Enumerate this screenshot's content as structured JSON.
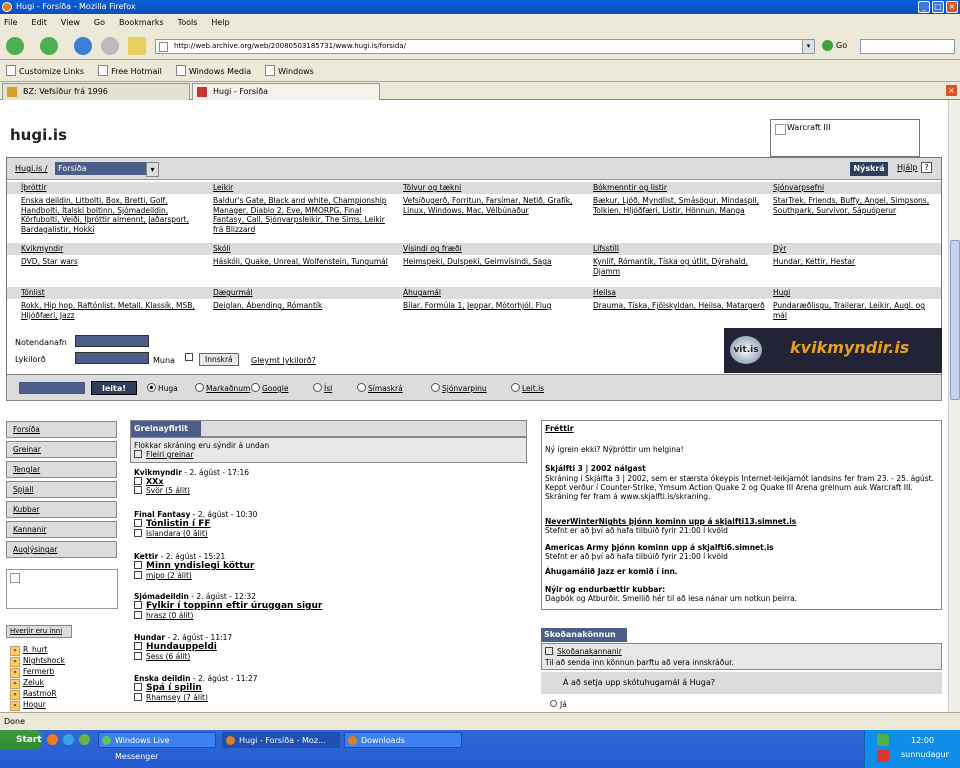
{
  "window": {
    "title": "Hugi - Forsíða - Mozilla Firefox"
  },
  "menu": [
    "File",
    "Edit",
    "View",
    "Go",
    "Bookmarks",
    "Tools",
    "Help"
  ],
  "nav": {
    "url": "http://web.archive.org/web/20080503185731/www.hugi.is/forsida/",
    "go_label": "Go"
  },
  "bookmarks": [
    "Customize Links",
    "Free Hotmail",
    "Windows Media",
    "Windows"
  ],
  "tabs": [
    {
      "label": "BZ: Vefsíður frá 1996"
    },
    {
      "label": "Hugi - Forsíða"
    }
  ],
  "page": {
    "logo": "hugi.is",
    "ad_label": "Warcraft III",
    "crumb": "Hugi.is /",
    "crumb_select": "Forsíða",
    "nyskra": "Nýskrá",
    "hjalp": "Hjálp",
    "categories": [
      {
        "head": "Íþróttir",
        "links": "Enska deildin, Litbolti, Box, Bretti, Golf, Handbolti, Ítalski boltinn, Sjómadeildin, Körfubolti, Veiði, Íþróttir almennt, Jaðarsport, Bardagalistir, Hokkí"
      },
      {
        "head": "Leikir",
        "links": "Baldur's Gate, Black and white, Championship Manager, Diablo 2, Eve, MMORPG, Final Fantasy, Call, Sjónvarpsleikir, The Sims, Leikir frá Blizzard"
      },
      {
        "head": "Tölvur og tækni",
        "links": "Vefsíðugerð, Forritun, Farsímar, Netið, Grafík, Linux, Windows, Mac, Vélbúnaður"
      },
      {
        "head": "Bókmenntir og listir",
        "links": "Bækur, Ljóð, Myndlist, Smásögur, Mindaspil, Tolkien, Hljóðfæri, Listir, Hönnun, Manga"
      },
      {
        "head": "Sjónvarpsefni",
        "links": "StarTrek, Friends, Buffy, Angel, Simpsons, Southpark, Survivor, Sápuóperur"
      },
      {
        "head": "Kvikmyndir",
        "links": "DVD, Star wars"
      },
      {
        "head": "Skóli",
        "links": "Háskóli, Quake, Unreal, Wolfenstein, Tungumál"
      },
      {
        "head": "Vísindi og fræði",
        "links": "Heimspeki, Dulspeki, Geimvísindi, Saga"
      },
      {
        "head": "Lífsstíll",
        "links": "Kynlíf, Rómantík, Tíska og útlit, Dýrahald, Djamm"
      },
      {
        "head": "Dýr",
        "links": "Hundar, Kettir, Hestar"
      },
      {
        "head": "Tónlist",
        "links": "Rokk, Hip hop, Raftónlist, Metall, Klassík, MSB, Hljóðfæri, Jazz"
      },
      {
        "head": "Dægurmál",
        "links": "Deiglan, Ábending, Rómantík"
      },
      {
        "head": "Áhugamál",
        "links": "Bílar, Formúla 1, Jeppar, Mótorhjól, Flug"
      },
      {
        "head": "Heilsa",
        "links": "Drauma, Tíska, Fjölskyldan, Heilsa, Matargerð"
      },
      {
        "head": "Hugi",
        "links": "Pundaræðlisgu, Trailerar, Leikir, Augl. og mál"
      }
    ],
    "login": {
      "user_label": "Notendanafn",
      "pass_label": "Lykilorð",
      "remember_label": "Muna",
      "login_btn": "Innskrá",
      "forgot": "Gleymt lykilorð?"
    },
    "banner": {
      "left": "vit.is",
      "right": "kvikmyndir.is"
    },
    "search": {
      "button": "leita!",
      "options": [
        "Huga",
        "Markaðnum",
        "Google",
        "Ísl",
        "Símaskrá",
        "Sjónvarpinu",
        "Leit.is"
      ]
    },
    "left_nav": [
      "Forsíða",
      "Greinar",
      "Tenglar",
      "Spjall",
      "Kubbar",
      "Kannanir",
      "Auglýsingar"
    ],
    "hver_head": "Hverjir eru inni",
    "hver": [
      "R_hurt",
      "Nightshock",
      "Fermerb",
      "Zeluk",
      "RastmoR",
      "Hogur"
    ],
    "mid": {
      "title": "Greinayfirlit",
      "intro1": "Flokkar skráning eru sýndir á undan",
      "intro2": "Fleiri greinar",
      "posts": [
        {
          "cat": "Kvikmyndir",
          "time": "2. ágúst - 17:16",
          "title": "XXx",
          "sub": "Svör (5 álit)"
        },
        {
          "cat": "Final Fantasy",
          "time": "2. ágúst - 10:30",
          "title": "Tónlistin í FF",
          "sub": "Islandara (0 álit)"
        },
        {
          "cat": "Kettir",
          "time": "2. ágúst - 15:21",
          "title": "Minn yndislegi köttur",
          "sub": "mipo (2 álit)"
        },
        {
          "cat": "Sjómadeildin",
          "time": "2. ágúst - 12:32",
          "title": "Fylkir í toppinn eftir úruggan sigur",
          "sub": "hrasz (0 álit)"
        },
        {
          "cat": "Hundar",
          "time": "2. ágúst - 11:17",
          "title": "Hundauppeldi",
          "sub": "Sess (6 álit)"
        },
        {
          "cat": "Enska deildin",
          "time": "2. ágúst - 11:27",
          "title": "Spá í spilin",
          "sub": "Rhamsey (7 álit)"
        }
      ]
    },
    "right": {
      "title": "Fréttir",
      "line1": "Ný ígrein ekki? Nýþróttir um helgina!",
      "h2": "Skjálfti 3 | 2002 nálgast",
      "p2": "Skráning í Skjálfta 3 | 2002, sem er stærsta ókeypis Internet-leikjamót landsins fer fram 23. - 25. ágúst. Keppt verður í Counter-Strike, Ýmsum Action Quake 2 og Quake III Arena greinum auk Warcraft III. Skráning fer fram á www.skjalfti.is/skraning.",
      "h3": "NeverWinterNights þjónn kominn upp á skjalfti13.simnet.is",
      "p3": "Stefnt er að því að hafa tilbúið fyrir 21:00 í kvöld",
      "h4": "Americas Army þjónn kominn upp á skjalfti6.simnet.is",
      "p4": "Stefnt er að því að hafa tilbúið fyrir 21:00 í kvöld",
      "h5": "Áhugamálið Jazz er komið í inn.",
      "h6": "Nýir og endurbættir kubbar:",
      "p6": "Dagbók og Atburðir. Smellið hér til að lesa nánar um notkun þeirra."
    },
    "sko": {
      "title": "Skoðanakönnun",
      "bar1": "Skoðanakannanir",
      "bar2": "Til að senda inn könnun þarftu að vera innskráður.",
      "question": "Á að setja upp skótuhugamál á Huga?",
      "answer": "Já"
    }
  },
  "status": "Done",
  "taskbar": {
    "start": "Start",
    "tasks": [
      "Windows Live Messenger",
      "Hugi - Forsíða - Moz...",
      "Downloads"
    ],
    "clock": "12:00",
    "day": "sunnudagur"
  }
}
